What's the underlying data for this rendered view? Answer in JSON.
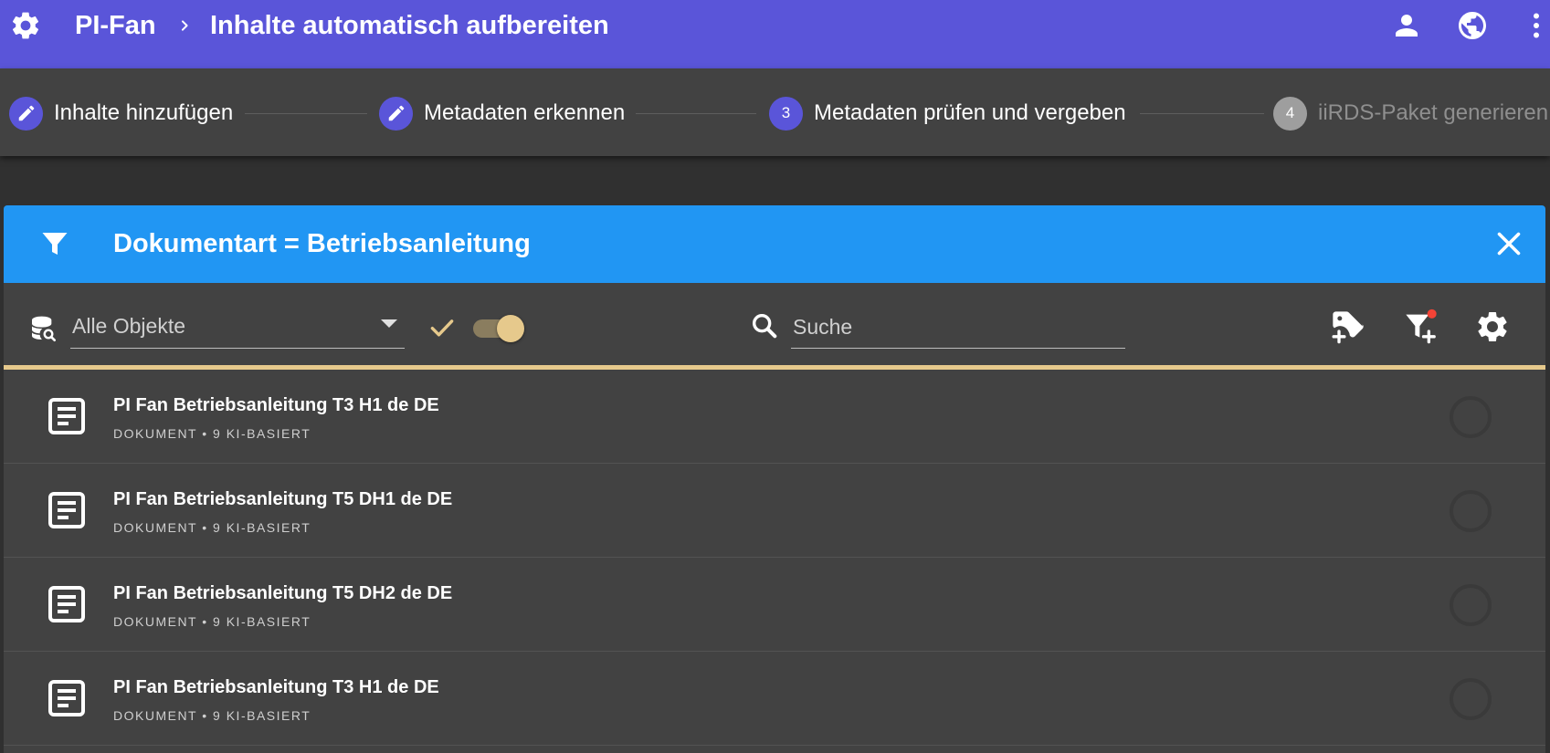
{
  "topbar": {
    "app_name": "PI-Fan",
    "page_title": "Inhalte automatisch aufbereiten",
    "icons": [
      "gear-icon",
      "chevron-right-icon",
      "person-icon",
      "globe-icon",
      "more-vert-icon"
    ]
  },
  "stepper": {
    "steps": [
      {
        "label": "Inhalte hinzufügen",
        "marker": "edit-icon",
        "state": "done"
      },
      {
        "label": "Metadaten erkennen",
        "marker": "edit-icon",
        "state": "done"
      },
      {
        "label": "Metadaten prüfen und vergeben",
        "marker": "3",
        "state": "active"
      },
      {
        "label": "iiRDS-Paket generieren",
        "marker": "4",
        "state": "inactive"
      }
    ]
  },
  "filter": {
    "text": "Dokumentart = Betriebsanleitung",
    "icons": [
      "filter-icon",
      "close-icon"
    ]
  },
  "toolbar": {
    "object_select_value": "Alle Objekte",
    "search_placeholder": "Suche",
    "toggle_on": true,
    "icons": [
      "database-search-icon",
      "check-icon",
      "search-icon",
      "tag-plus-icon",
      "filter-plus-icon",
      "gear-icon"
    ]
  },
  "items": [
    {
      "title": "PI Fan Betriebsanleitung T3 H1 de DE",
      "subtitle": "DOKUMENT • 9 KI-BASIERT"
    },
    {
      "title": "PI Fan Betriebsanleitung T5 DH1 de DE",
      "subtitle": "DOKUMENT • 9 KI-BASIERT"
    },
    {
      "title": "PI Fan Betriebsanleitung T5 DH2 de DE",
      "subtitle": "DOKUMENT • 9 KI-BASIERT"
    },
    {
      "title": "PI Fan Betriebsanleitung T3 H1 de DE",
      "subtitle": "DOKUMENT • 9 KI-BASIERT"
    }
  ],
  "colors": {
    "primary": "#5a55d9",
    "filter_bar": "#2196f3",
    "accent": "#e6c98c",
    "surface": "#424242",
    "background": "#303030",
    "notification_dot": "#f44336"
  }
}
